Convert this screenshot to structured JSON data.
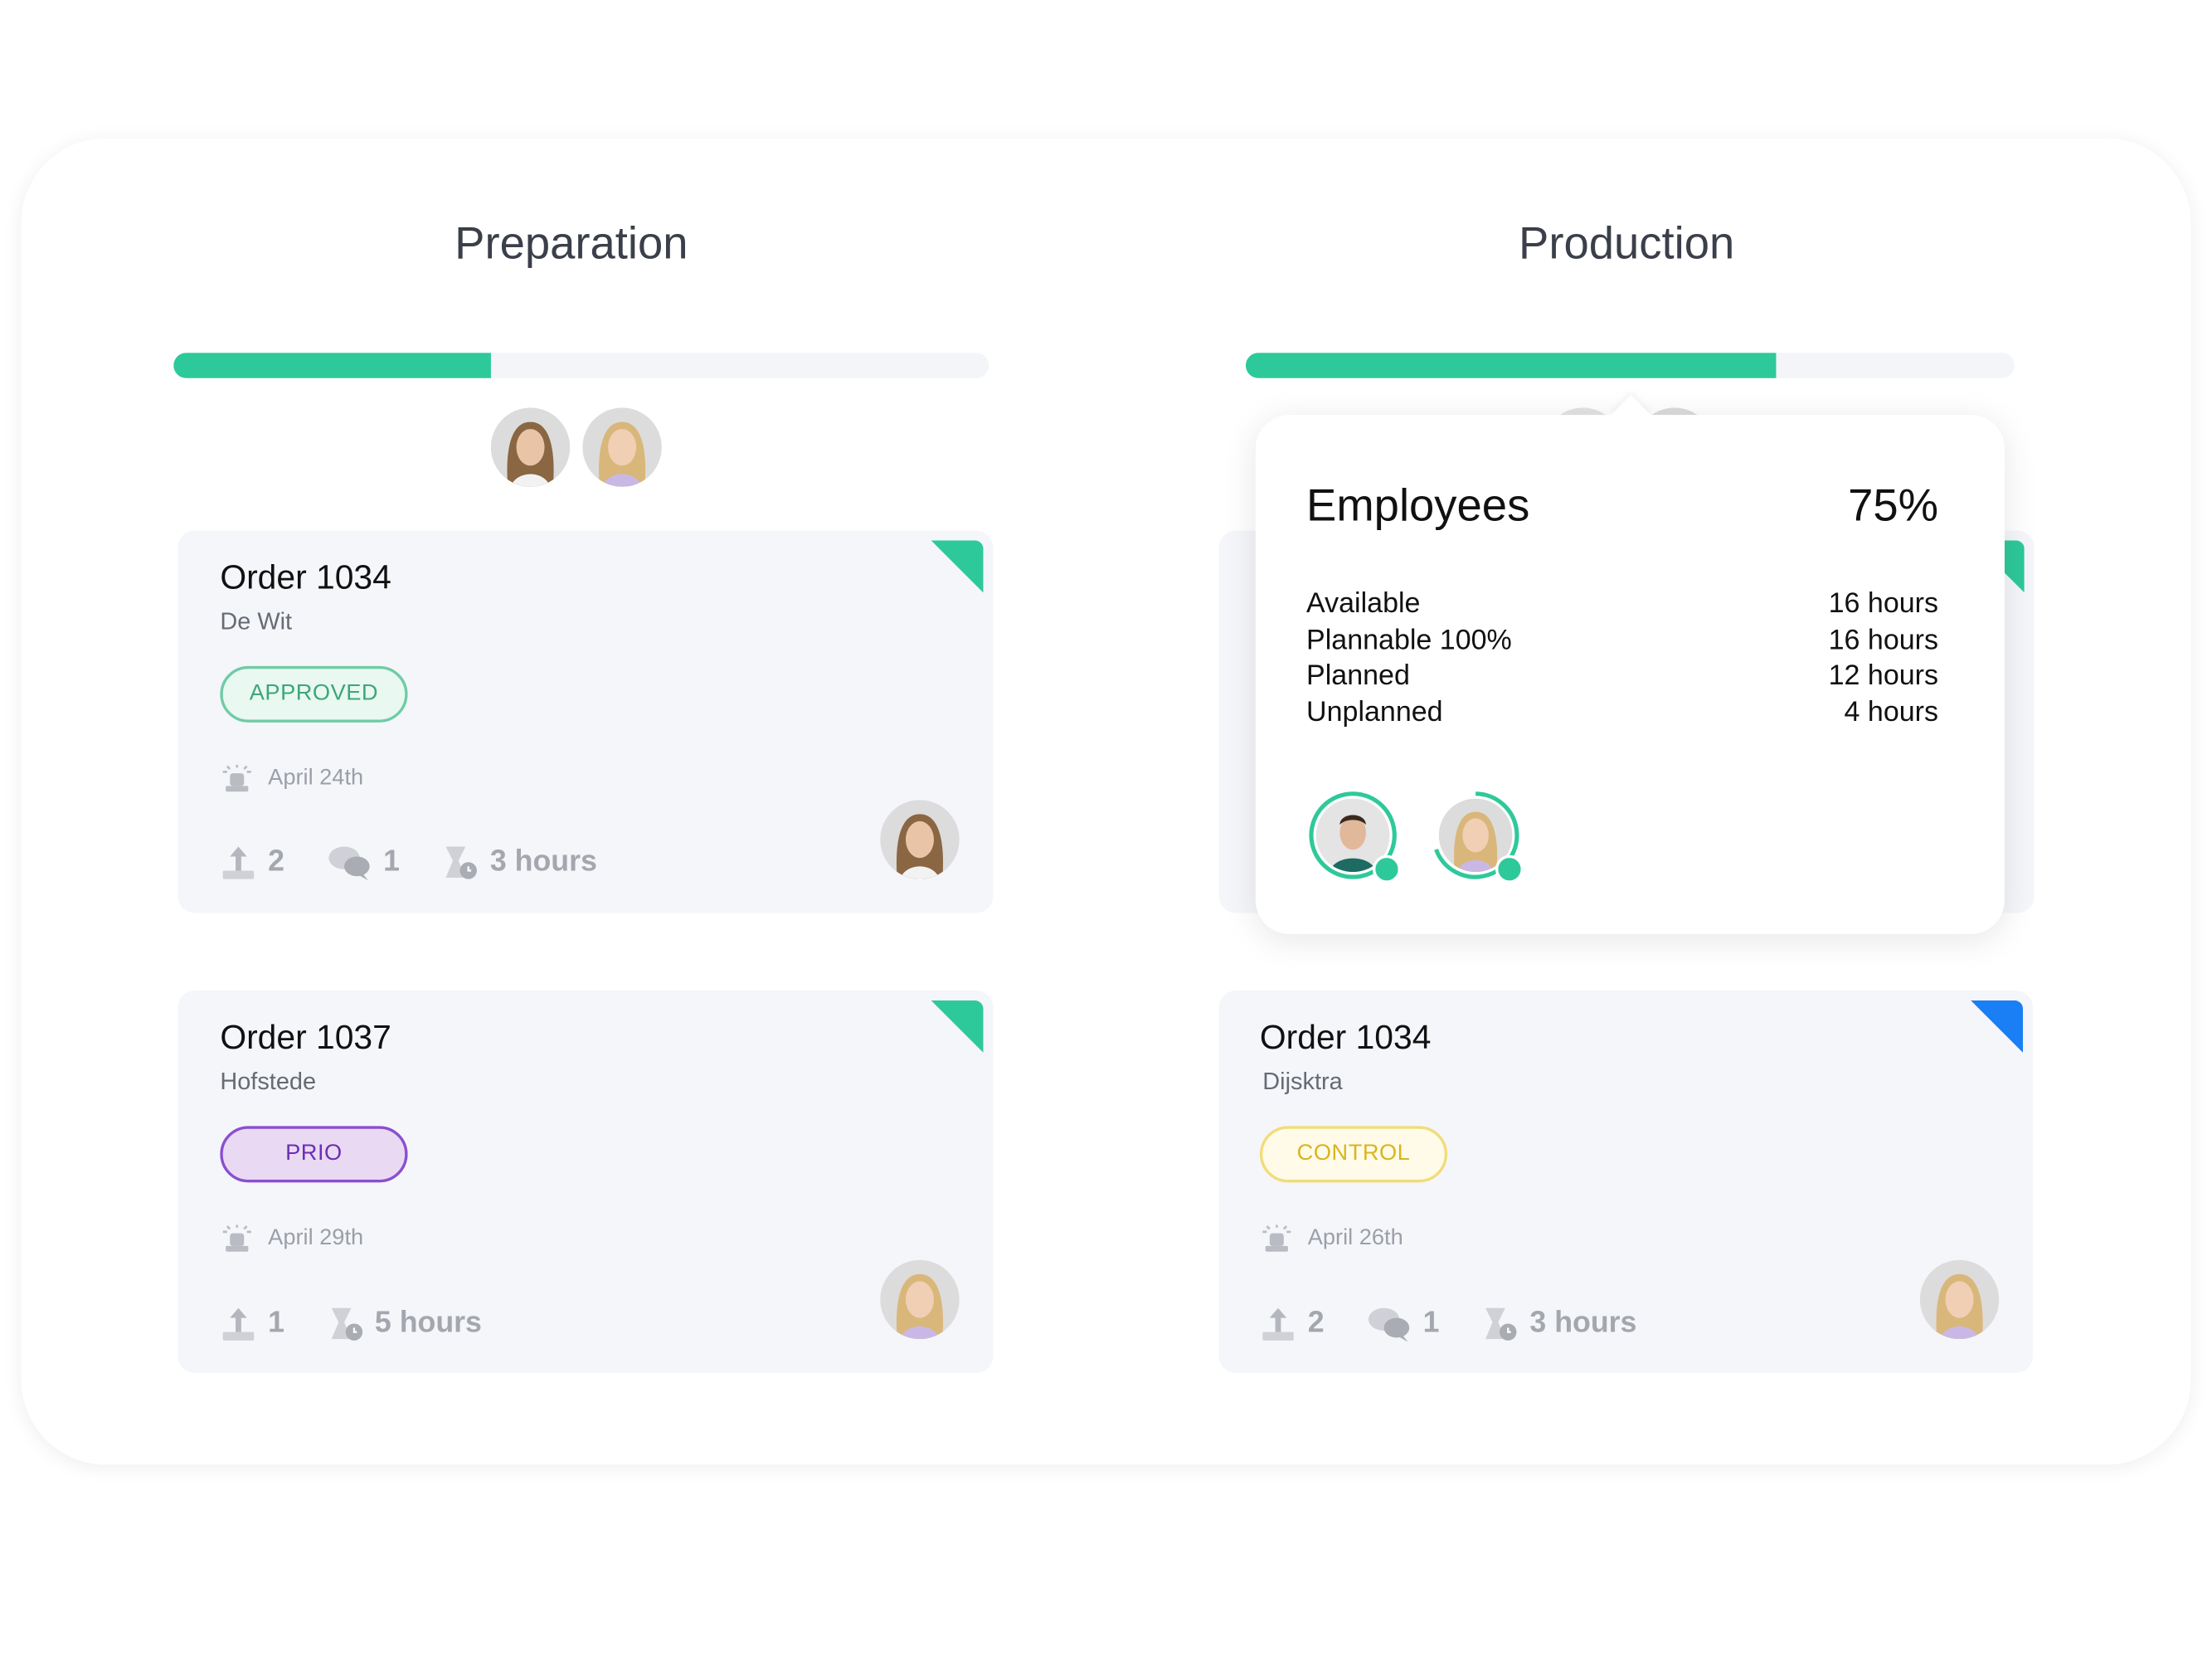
{
  "colors": {
    "accent": "#2ec99a",
    "blue": "#1a7ff5",
    "approved": "#3ea67a",
    "prio": "#7a3fc4",
    "control": "#e5c43a"
  },
  "columns": [
    {
      "title": "Preparation",
      "progress_fraction": 0.39,
      "cards": [
        {
          "title": "Order 1034",
          "client": "De Wit",
          "badge": "APPROVED",
          "date": "April 24th",
          "uploads": "2",
          "comments": "1",
          "duration": "3 hours",
          "corner_color": "#2ec99a"
        },
        {
          "title": "Order 1037",
          "client": "Hofstede",
          "badge": "PRIO",
          "date": "April 29th",
          "uploads": "1",
          "duration": "5 hours",
          "corner_color": "#2ec99a"
        }
      ]
    },
    {
      "title": "Production",
      "progress_fraction": 0.69,
      "cards": [
        {
          "title": "Order 1034",
          "client": "Dijsktra",
          "badge": "CONTROL",
          "date": "April 26th",
          "uploads": "2",
          "comments": "1",
          "duration": "3 hours",
          "corner_color": "#1a7ff5"
        }
      ]
    }
  ],
  "tooltip": {
    "title": "Employees",
    "percent": "75%",
    "rows": [
      {
        "label": "Available",
        "value": "16 hours"
      },
      {
        "label": "Plannable 100%",
        "value": "16 hours"
      },
      {
        "label": "Planned",
        "value": "12 hours"
      },
      {
        "label": "Unplanned",
        "value": "4 hours"
      }
    ]
  }
}
